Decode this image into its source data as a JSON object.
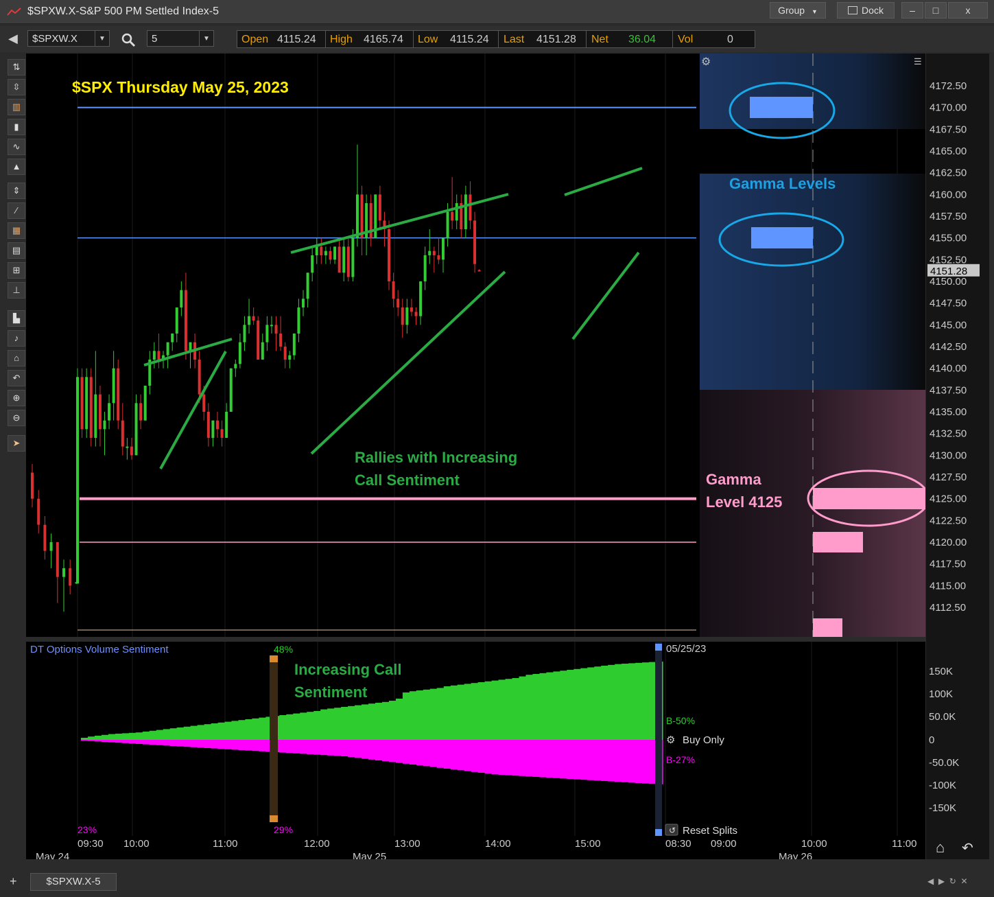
{
  "window": {
    "title": "$SPXW.X-S&P 500 PM Settled Index-5",
    "group_label": "Group",
    "dock_label": "Dock",
    "minimize_label": "–",
    "maximize_label": "□",
    "close_label": "x"
  },
  "toolbar": {
    "back_icon": "back-arrow-icon",
    "symbol": "$SPXW.X",
    "interval": "5",
    "quote": {
      "open_label": "Open",
      "open": "4115.24",
      "high_label": "High",
      "high": "4165.74",
      "low_label": "Low",
      "low": "4115.24",
      "last_label": "Last",
      "last": "4151.28",
      "net_label": "Net",
      "net": "36.04",
      "vol_label": "Vol",
      "vol": "0"
    }
  },
  "colors": {
    "up": "#33cc33",
    "down": "#d93030",
    "gamma_blue": "#5f95ff",
    "gamma_pink": "#ff9ccc",
    "annotation_yellow": "#ffee00",
    "annotation_green": "#2bab44",
    "annotation_blue": "#1fa0e0",
    "sentiment_buy": "#2ecc2e",
    "sentiment_sell": "#ff00ff"
  },
  "annotations": {
    "title": "$SPX Thursday May 25, 2023",
    "gamma_levels": "Gamma Levels",
    "gamma_level_line1": "Gamma",
    "gamma_level_line2": "Level 4125",
    "rallies_line1": "Rallies with Increasing",
    "rallies_line2": "Call Sentiment",
    "increasing_line1": "Increasing Call",
    "increasing_line2": "Sentiment"
  },
  "price_axis": {
    "ticks": [
      "4172.50",
      "4170.00",
      "4167.50",
      "4165.00",
      "4162.50",
      "4160.00",
      "4157.50",
      "4155.00",
      "4152.50",
      "4150.00",
      "4147.50",
      "4145.00",
      "4142.50",
      "4140.00",
      "4137.50",
      "4135.00",
      "4132.50",
      "4130.00",
      "4127.50",
      "4125.00",
      "4122.50",
      "4120.00",
      "4117.50",
      "4115.00",
      "4112.50"
    ],
    "last_price_badge": "4151.28"
  },
  "sentiment": {
    "title": "DT Options Volume Sentiment",
    "pct_top": "48%",
    "pct_bottom_right": "29%",
    "pct_bottom_left": "23%",
    "date_label": "05/25/23",
    "buy_pct": "B-50%",
    "sell_pct": "B-27%",
    "buy_only_label": "Buy Only",
    "reset_splits_label": "Reset Splits",
    "axis_ticks": [
      "150K",
      "100K",
      "50.0K",
      "0",
      "-50.0K",
      "-100K",
      "-150K"
    ]
  },
  "time_axis": {
    "times": [
      "09:30",
      "10:00",
      "11:00",
      "12:00",
      "13:00",
      "14:00",
      "15:00",
      "08:30",
      "09:00",
      "10:00",
      "11:00"
    ],
    "dates": [
      "May 24",
      "May 25",
      "May 26"
    ]
  },
  "tabs": {
    "active": "$SPXW.X-5",
    "add_label": "+"
  },
  "chart_data": {
    "type": "candlestick",
    "interval_minutes": 5,
    "symbol": "$SPXW.X",
    "ylim": [
      4110,
      4175
    ],
    "gamma_levels": [
      4170.0,
      4155.0,
      4125.0,
      4120.0
    ],
    "prior_day_close_sequence": [
      {
        "o": 4128,
        "h": 4129,
        "l": 4124,
        "c": 4125
      },
      {
        "o": 4125,
        "h": 4126,
        "l": 4121,
        "c": 4122
      },
      {
        "o": 4122,
        "h": 4123,
        "l": 4118,
        "c": 4119
      },
      {
        "o": 4119,
        "h": 4121,
        "l": 4117,
        "c": 4120
      },
      {
        "o": 4120,
        "h": 4120,
        "l": 4113,
        "c": 4116
      },
      {
        "o": 4116,
        "h": 4118,
        "l": 4112,
        "c": 4117
      },
      {
        "o": 4117,
        "h": 4118,
        "l": 4114,
        "c": 4115
      },
      {
        "o": 4115.3,
        "h": 4115.6,
        "l": 4115.2,
        "c": 4115.4
      }
    ],
    "candles": [
      {
        "o": 4115.24,
        "h": 4140,
        "l": 4115.24,
        "c": 4139
      },
      {
        "o": 4139,
        "h": 4140,
        "l": 4132,
        "c": 4133
      },
      {
        "o": 4133,
        "h": 4140,
        "l": 4132,
        "c": 4139
      },
      {
        "o": 4139,
        "h": 4140,
        "l": 4131,
        "c": 4132
      },
      {
        "o": 4132,
        "h": 4142,
        "l": 4131,
        "c": 4137
      },
      {
        "o": 4137,
        "h": 4138,
        "l": 4131,
        "c": 4133
      },
      {
        "o": 4133,
        "h": 4135,
        "l": 4130,
        "c": 4134
      },
      {
        "o": 4134,
        "h": 4137,
        "l": 4133,
        "c": 4136
      },
      {
        "o": 4136,
        "h": 4142,
        "l": 4134,
        "c": 4140
      },
      {
        "o": 4140,
        "h": 4141,
        "l": 4133,
        "c": 4134
      },
      {
        "o": 4134,
        "h": 4136,
        "l": 4130,
        "c": 4131
      },
      {
        "o": 4131,
        "h": 4132,
        "l": 4129.5,
        "c": 4131
      },
      {
        "o": 4131,
        "h": 4132,
        "l": 4129.5,
        "c": 4130
      },
      {
        "o": 4130,
        "h": 4137,
        "l": 4130,
        "c": 4136
      },
      {
        "o": 4136,
        "h": 4137,
        "l": 4133,
        "c": 4134
      },
      {
        "o": 4134,
        "h": 4138,
        "l": 4134,
        "c": 4138
      },
      {
        "o": 4138,
        "h": 4142,
        "l": 4137,
        "c": 4141
      },
      {
        "o": 4141,
        "h": 4143,
        "l": 4140,
        "c": 4142
      },
      {
        "o": 4142,
        "h": 4144,
        "l": 4140,
        "c": 4141
      },
      {
        "o": 4141,
        "h": 4142,
        "l": 4140,
        "c": 4141.5
      },
      {
        "o": 4141.5,
        "h": 4143,
        "l": 4140,
        "c": 4143
      },
      {
        "o": 4143,
        "h": 4144,
        "l": 4142,
        "c": 4144
      },
      {
        "o": 4144,
        "h": 4147,
        "l": 4143,
        "c": 4147
      },
      {
        "o": 4147,
        "h": 4150,
        "l": 4146,
        "c": 4149
      },
      {
        "o": 4149,
        "h": 4151,
        "l": 4141,
        "c": 4142
      },
      {
        "o": 4142,
        "h": 4143,
        "l": 4140,
        "c": 4143
      },
      {
        "o": 4143,
        "h": 4144,
        "l": 4140,
        "c": 4141
      },
      {
        "o": 4141,
        "h": 4142,
        "l": 4136,
        "c": 4137
      },
      {
        "o": 4137,
        "h": 4138,
        "l": 4134,
        "c": 4135
      },
      {
        "o": 4135,
        "h": 4136,
        "l": 4131,
        "c": 4132
      },
      {
        "o": 4132,
        "h": 4134,
        "l": 4131,
        "c": 4134
      },
      {
        "o": 4134,
        "h": 4135,
        "l": 4132,
        "c": 4133
      },
      {
        "o": 4133,
        "h": 4134,
        "l": 4131,
        "c": 4132
      },
      {
        "o": 4132,
        "h": 4136,
        "l": 4132,
        "c": 4135
      },
      {
        "o": 4135,
        "h": 4140,
        "l": 4135,
        "c": 4140
      },
      {
        "o": 4140,
        "h": 4141,
        "l": 4139,
        "c": 4140.5
      },
      {
        "o": 4140.5,
        "h": 4144,
        "l": 4140,
        "c": 4143
      },
      {
        "o": 4143,
        "h": 4146,
        "l": 4142,
        "c": 4145
      },
      {
        "o": 4145,
        "h": 4148,
        "l": 4144,
        "c": 4146
      },
      {
        "o": 4146,
        "h": 4147,
        "l": 4145,
        "c": 4145.5
      },
      {
        "o": 4145.5,
        "h": 4146,
        "l": 4141,
        "c": 4141
      },
      {
        "o": 4141,
        "h": 4144,
        "l": 4141,
        "c": 4143
      },
      {
        "o": 4143,
        "h": 4146,
        "l": 4142,
        "c": 4145
      },
      {
        "o": 4145,
        "h": 4146,
        "l": 4144,
        "c": 4145
      },
      {
        "o": 4145,
        "h": 4146,
        "l": 4142,
        "c": 4144
      },
      {
        "o": 4144,
        "h": 4146,
        "l": 4142,
        "c": 4142.5
      },
      {
        "o": 4142.5,
        "h": 4143,
        "l": 4140,
        "c": 4141
      },
      {
        "o": 4141,
        "h": 4142,
        "l": 4140,
        "c": 4141.5
      },
      {
        "o": 4141.5,
        "h": 4144,
        "l": 4141,
        "c": 4144
      },
      {
        "o": 4144,
        "h": 4148,
        "l": 4143,
        "c": 4147
      },
      {
        "o": 4147,
        "h": 4149,
        "l": 4146,
        "c": 4148
      },
      {
        "o": 4148,
        "h": 4151,
        "l": 4147,
        "c": 4151
      },
      {
        "o": 4151,
        "h": 4154,
        "l": 4150,
        "c": 4153
      },
      {
        "o": 4153,
        "h": 4155,
        "l": 4152,
        "c": 4154
      },
      {
        "o": 4154,
        "h": 4155,
        "l": 4152,
        "c": 4153
      },
      {
        "o": 4153,
        "h": 4154,
        "l": 4152,
        "c": 4153.5
      },
      {
        "o": 4153.5,
        "h": 4154,
        "l": 4152,
        "c": 4152.5
      },
      {
        "o": 4152.5,
        "h": 4154,
        "l": 4152,
        "c": 4154
      },
      {
        "o": 4154,
        "h": 4155,
        "l": 4151,
        "c": 4151
      },
      {
        "o": 4151,
        "h": 4155,
        "l": 4150,
        "c": 4154
      },
      {
        "o": 4154,
        "h": 4155,
        "l": 4150,
        "c": 4150.5
      },
      {
        "o": 4150.5,
        "h": 4156,
        "l": 4150,
        "c": 4155
      },
      {
        "o": 4155,
        "h": 4165.74,
        "l": 4154,
        "c": 4160
      },
      {
        "o": 4160,
        "h": 4161,
        "l": 4153,
        "c": 4155
      },
      {
        "o": 4155,
        "h": 4160,
        "l": 4153,
        "c": 4159
      },
      {
        "o": 4159,
        "h": 4160,
        "l": 4154,
        "c": 4155
      },
      {
        "o": 4155,
        "h": 4160,
        "l": 4155,
        "c": 4160
      },
      {
        "o": 4160,
        "h": 4161,
        "l": 4156,
        "c": 4157
      },
      {
        "o": 4157,
        "h": 4158,
        "l": 4154,
        "c": 4156
      },
      {
        "o": 4156,
        "h": 4157,
        "l": 4149,
        "c": 4150
      },
      {
        "o": 4150,
        "h": 4151,
        "l": 4147,
        "c": 4148
      },
      {
        "o": 4148,
        "h": 4149,
        "l": 4146,
        "c": 4147
      },
      {
        "o": 4147,
        "h": 4148,
        "l": 4143.5,
        "c": 4145
      },
      {
        "o": 4145,
        "h": 4148,
        "l": 4144,
        "c": 4147
      },
      {
        "o": 4147,
        "h": 4148,
        "l": 4146,
        "c": 4146.5
      },
      {
        "o": 4146.5,
        "h": 4147,
        "l": 4145,
        "c": 4146
      },
      {
        "o": 4146,
        "h": 4150,
        "l": 4145,
        "c": 4150
      },
      {
        "o": 4150,
        "h": 4154,
        "l": 4149,
        "c": 4153
      },
      {
        "o": 4153,
        "h": 4156,
        "l": 4152,
        "c": 4153.5
      },
      {
        "o": 4153.5,
        "h": 4154,
        "l": 4151,
        "c": 4153
      },
      {
        "o": 4153,
        "h": 4155,
        "l": 4152,
        "c": 4152.5
      },
      {
        "o": 4152.5,
        "h": 4155,
        "l": 4151,
        "c": 4155
      },
      {
        "o": 4155,
        "h": 4159,
        "l": 4154,
        "c": 4158
      },
      {
        "o": 4158,
        "h": 4162,
        "l": 4156,
        "c": 4157
      },
      {
        "o": 4157,
        "h": 4160,
        "l": 4156,
        "c": 4159
      },
      {
        "o": 4159,
        "h": 4160,
        "l": 4155,
        "c": 4156
      },
      {
        "o": 4156,
        "h": 4161,
        "l": 4155,
        "c": 4160
      },
      {
        "o": 4160,
        "h": 4161.5,
        "l": 4156,
        "c": 4157
      },
      {
        "o": 4157,
        "h": 4158,
        "l": 4151,
        "c": 4152
      },
      {
        "o": 4151.3,
        "h": 4151.4,
        "l": 4151.2,
        "c": 4151.28
      }
    ],
    "sentiment_buy_k": [
      0,
      5,
      8,
      10,
      12,
      14,
      15,
      16,
      17,
      18,
      20,
      22,
      24,
      26,
      28,
      30,
      32,
      34,
      36,
      38,
      40,
      42,
      44,
      46,
      48,
      50,
      52,
      54,
      56,
      58,
      60,
      62,
      64,
      66,
      68,
      70,
      74,
      76,
      78,
      80,
      82,
      84,
      86,
      88,
      90,
      92,
      95,
      100,
      115,
      118,
      120,
      122,
      124,
      126,
      130,
      132,
      134,
      136,
      138,
      140,
      142,
      144,
      146,
      148,
      150,
      154,
      158,
      160,
      162,
      164,
      166,
      168,
      170,
      172,
      174,
      176,
      178,
      180,
      182,
      184,
      185,
      186,
      187,
      188,
      189,
      190
    ],
    "sentiment_sell_k": [
      0,
      -2,
      -3,
      -4,
      -5,
      -6,
      -7,
      -8,
      -9,
      -10,
      -11,
      -12,
      -13,
      -14,
      -15,
      -16,
      -17,
      -18,
      -19,
      -20,
      -21,
      -22,
      -23,
      -24,
      -25,
      -26,
      -27,
      -28,
      -29,
      -30,
      -31,
      -32,
      -33,
      -34,
      -35,
      -36,
      -37,
      -38,
      -39,
      -40,
      -42,
      -44,
      -46,
      -48,
      -50,
      -52,
      -54,
      -56,
      -58,
      -60,
      -62,
      -64,
      -66,
      -68,
      -70,
      -72,
      -74,
      -76,
      -78,
      -80,
      -82,
      -84,
      -85,
      -86,
      -87,
      -88,
      -89,
      -90,
      -91,
      -92,
      -93,
      -94,
      -95,
      -96,
      -97,
      -98,
      -99,
      -100,
      -101,
      -102,
      -103,
      -104,
      -105,
      -106,
      -107,
      -108
    ]
  }
}
